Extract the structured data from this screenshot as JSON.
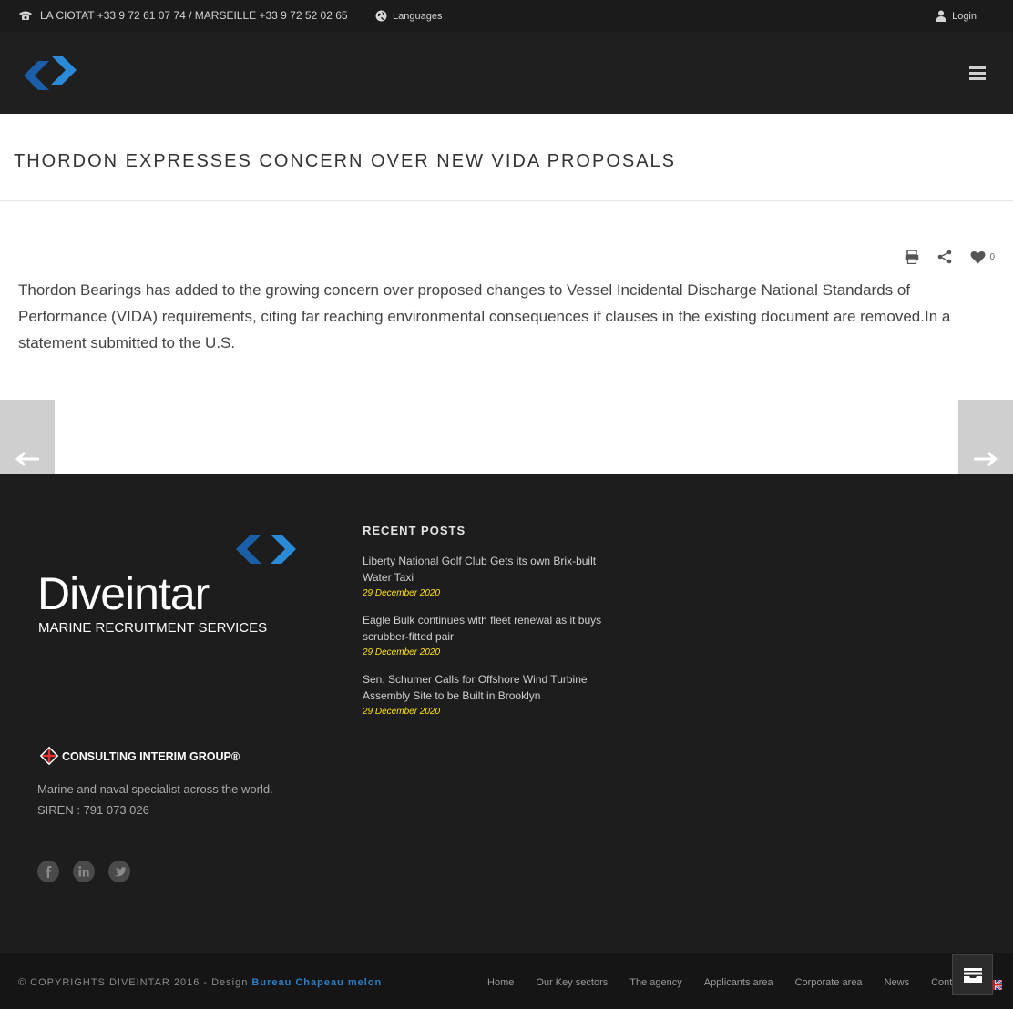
{
  "topbar": {
    "phone_text": "LA CIOTAT +33 9 72 61 07 74 / MARSEILLE +33 9 72 52 02 65",
    "languages_label": "Languages",
    "login_label": "Login"
  },
  "page": {
    "title": "THORDON EXPRESSES CONCERN OVER NEW VIDA PROPOSALS",
    "likes_count": "0",
    "body": "Thordon Bearings has added to the growing concern over proposed changes to Vessel Incidental Discharge National Standards of Performance (VIDA) requirements, citing far reaching environmental consequences if clauses in the existing document are removed.In a statement submitted to the U.S."
  },
  "footer": {
    "brand_name": "Diveintar",
    "brand_subtitle": "MARINE RECRUITMENT SERVICES",
    "group_name": "CONSULTING INTERIM GROUP®",
    "tagline": "Marine and naval specialist across the world.",
    "siren": "SIREN : 791 073 026",
    "recent_heading": "RECENT POSTS",
    "recent_posts": [
      {
        "title": "Liberty National Golf Club Gets its own Brix-built Water Taxi",
        "date": "29 December 2020"
      },
      {
        "title": "Eagle Bulk continues with fleet renewal as it buys scrubber-fitted pair",
        "date": "29 December 2020"
      },
      {
        "title": "Sen. Schumer Calls for Offshore Wind Turbine Assembly Site to be Built in Brooklyn",
        "date": "29 December 2020"
      }
    ]
  },
  "bottombar": {
    "copyright": "© COPYRIGHTS DIVEINTAR 2016 - Design ",
    "designer": "Bureau Chapeau melon",
    "menu": [
      "Home",
      "Our Key sectors",
      "The agency",
      "Applicants area",
      "Corporate area",
      "News",
      "Contact"
    ]
  },
  "colors": {
    "brand_blue": "#1a6fc0",
    "date_yellow": "#ffe200",
    "footer_bg": "#1d1d1d"
  }
}
